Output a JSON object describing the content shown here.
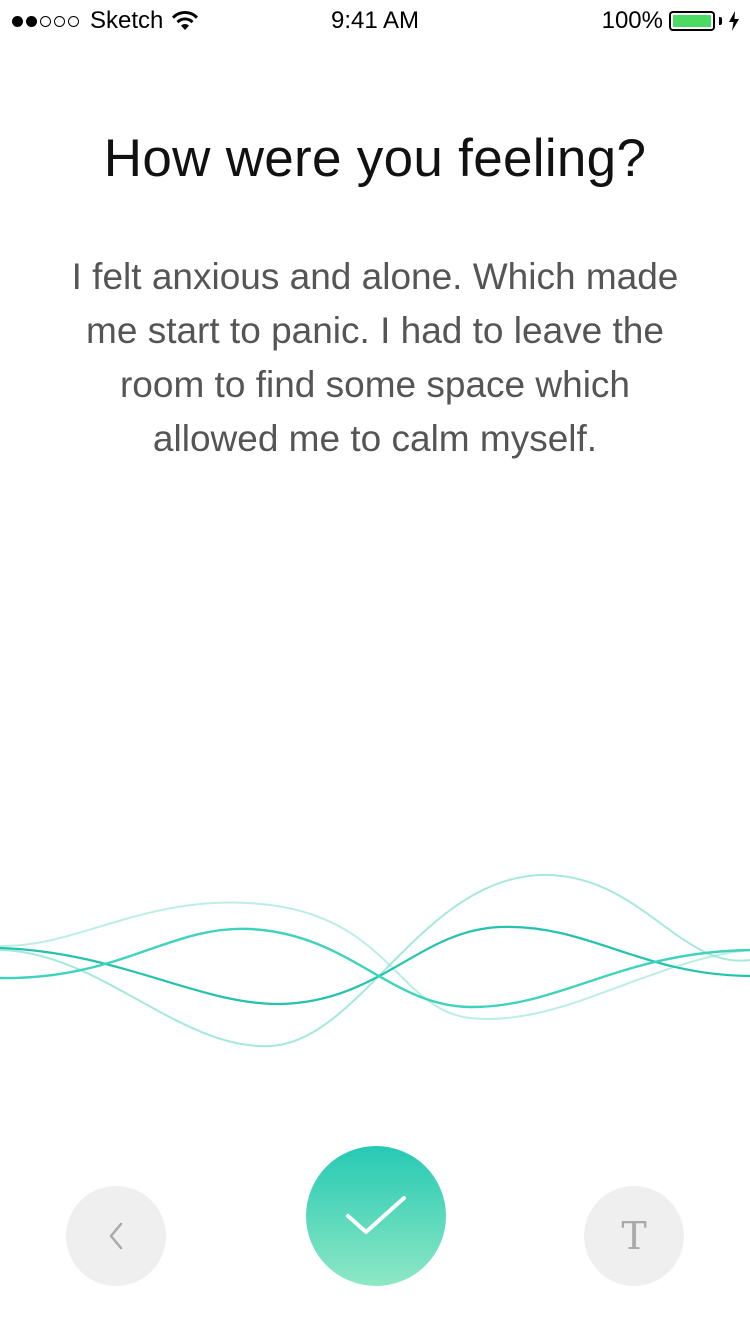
{
  "status_bar": {
    "carrier": "Sketch",
    "time": "9:41 AM",
    "battery": "100%",
    "battery_color": "#4cd964"
  },
  "screen": {
    "title": "How were you feeling?",
    "entry_text": "I felt anxious and alone. Which made me start to panic. I had to leave the room to find some space which allowed me to calm myself."
  },
  "controls": {
    "back_icon": "chevron-left-icon",
    "confirm_icon": "checkmark-icon",
    "text_mode_label": "T"
  },
  "colors": {
    "accent": "#26c9b4",
    "accent_light": "#8ee8c4",
    "button_bg": "#efefef"
  }
}
